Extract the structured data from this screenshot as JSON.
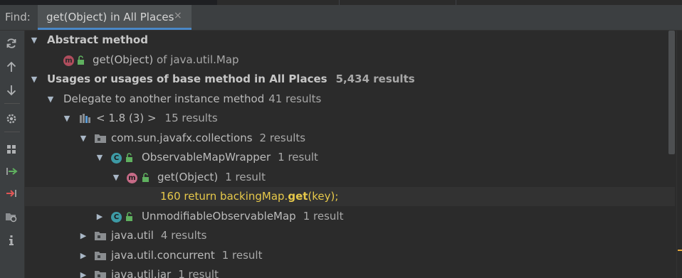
{
  "find": {
    "label": "Find:",
    "tab_label": "get(Object) in All Places",
    "tab_close": "×"
  },
  "toolbar": [
    {
      "name": "rerun-icon",
      "icon": "rerun"
    },
    {
      "name": "previous-occurrence-icon",
      "icon": "arrow-up"
    },
    {
      "name": "next-occurrence-icon",
      "icon": "arrow-down"
    },
    {
      "name": "settings-icon",
      "icon": "gear"
    },
    {
      "name": "group-by-icon",
      "icon": "grid"
    },
    {
      "name": "import-icon",
      "icon": "import"
    },
    {
      "name": "export-icon",
      "icon": "export"
    },
    {
      "name": "filter-icon",
      "icon": "filter"
    },
    {
      "name": "info-icon",
      "icon": "info"
    }
  ],
  "tree": {
    "rows": [
      {
        "label": "Abstract method",
        "count": ""
      },
      {
        "label": "get(Object)",
        "suffix": "of java.util.Map"
      },
      {
        "label": "Usages or usages of base method in All Places",
        "count": "5,434 results"
      },
      {
        "label": "Delegate to another instance method",
        "count": "41 results"
      },
      {
        "label": "< 1.8 (3) >",
        "count": "15 results"
      },
      {
        "label": "com.sun.javafx.collections",
        "count": "2 results"
      },
      {
        "label": "ObservableMapWrapper",
        "count": "1 result",
        "badge": "C"
      },
      {
        "label": "get(Object)",
        "count": "1 result",
        "badge": "m"
      },
      {
        "line": "160",
        "code_pre": "return backingMap.",
        "code_bold": "get",
        "code_post": "(key);"
      },
      {
        "label": "UnmodifiableObservableMap",
        "count": "1 result",
        "badge": "C"
      },
      {
        "label": "java.util",
        "count": "4 results"
      },
      {
        "label": "java.util.concurrent",
        "count": "1 result"
      },
      {
        "label": "java.util.jar",
        "count": "1 result"
      }
    ]
  },
  "colors": {
    "class_badge": "#3d9aa5",
    "method_badge": "#c76b87",
    "abstract_badge": "#b04d5d",
    "code_text": "#e6c84a",
    "selection_accent": "#4a88c7"
  }
}
